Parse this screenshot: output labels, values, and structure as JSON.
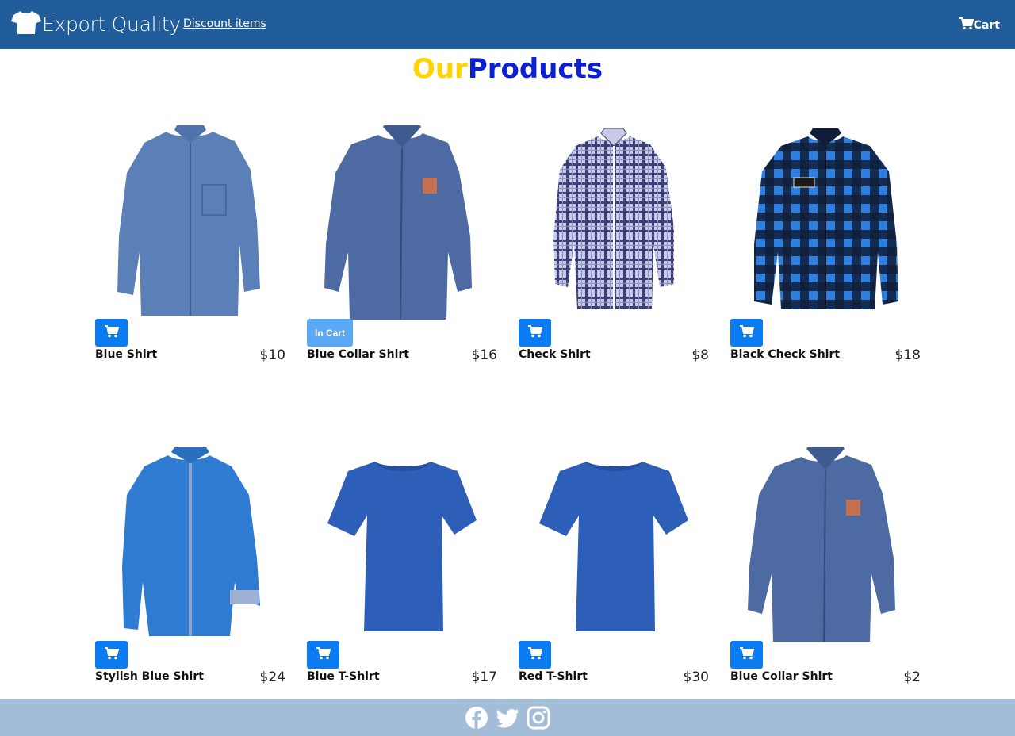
{
  "navbar": {
    "brand": "Export Quality",
    "brand_icon": "tshirt-icon",
    "link": "Discount items",
    "cart_label": "Cart",
    "color": "#225d9b"
  },
  "heading": {
    "part1": "Our",
    "part2": "Products",
    "color1": "#ffd400",
    "color2": "#0a1fd6"
  },
  "products": [
    {
      "name": "Blue Shirt",
      "price": "$10",
      "button": "",
      "in_cart": false,
      "image": "blue-shirt"
    },
    {
      "name": "Blue Collar Shirt",
      "price": "$16",
      "button": "In Cart",
      "in_cart": true,
      "image": "blue-collar-shirt"
    },
    {
      "name": "Check Shirt",
      "price": "$8",
      "button": "",
      "in_cart": false,
      "image": "check-shirt"
    },
    {
      "name": "Black Check Shirt",
      "price": "$18",
      "button": "",
      "in_cart": false,
      "image": "black-check-shirt"
    },
    {
      "name": "Stylish Blue Shirt",
      "price": "$24",
      "button": "",
      "in_cart": false,
      "image": "stylish-blue-shirt"
    },
    {
      "name": "Blue T-Shirt",
      "price": "$17",
      "button": "",
      "in_cart": false,
      "image": "blue-tshirt"
    },
    {
      "name": "Red T-Shirt",
      "price": "$30",
      "button": "",
      "in_cart": false,
      "image": "blue-tshirt"
    },
    {
      "name": "Blue Collar Shirt",
      "price": "$2",
      "button": "",
      "in_cart": false,
      "image": "blue-collar-shirt"
    }
  ],
  "footer": {
    "icons": [
      "facebook-icon",
      "twitter-icon",
      "instagram-icon"
    ],
    "color": "#a3bcd8"
  },
  "colors": {
    "button": "#0b7bf2",
    "button_in_cart": "#5aa9f6"
  }
}
